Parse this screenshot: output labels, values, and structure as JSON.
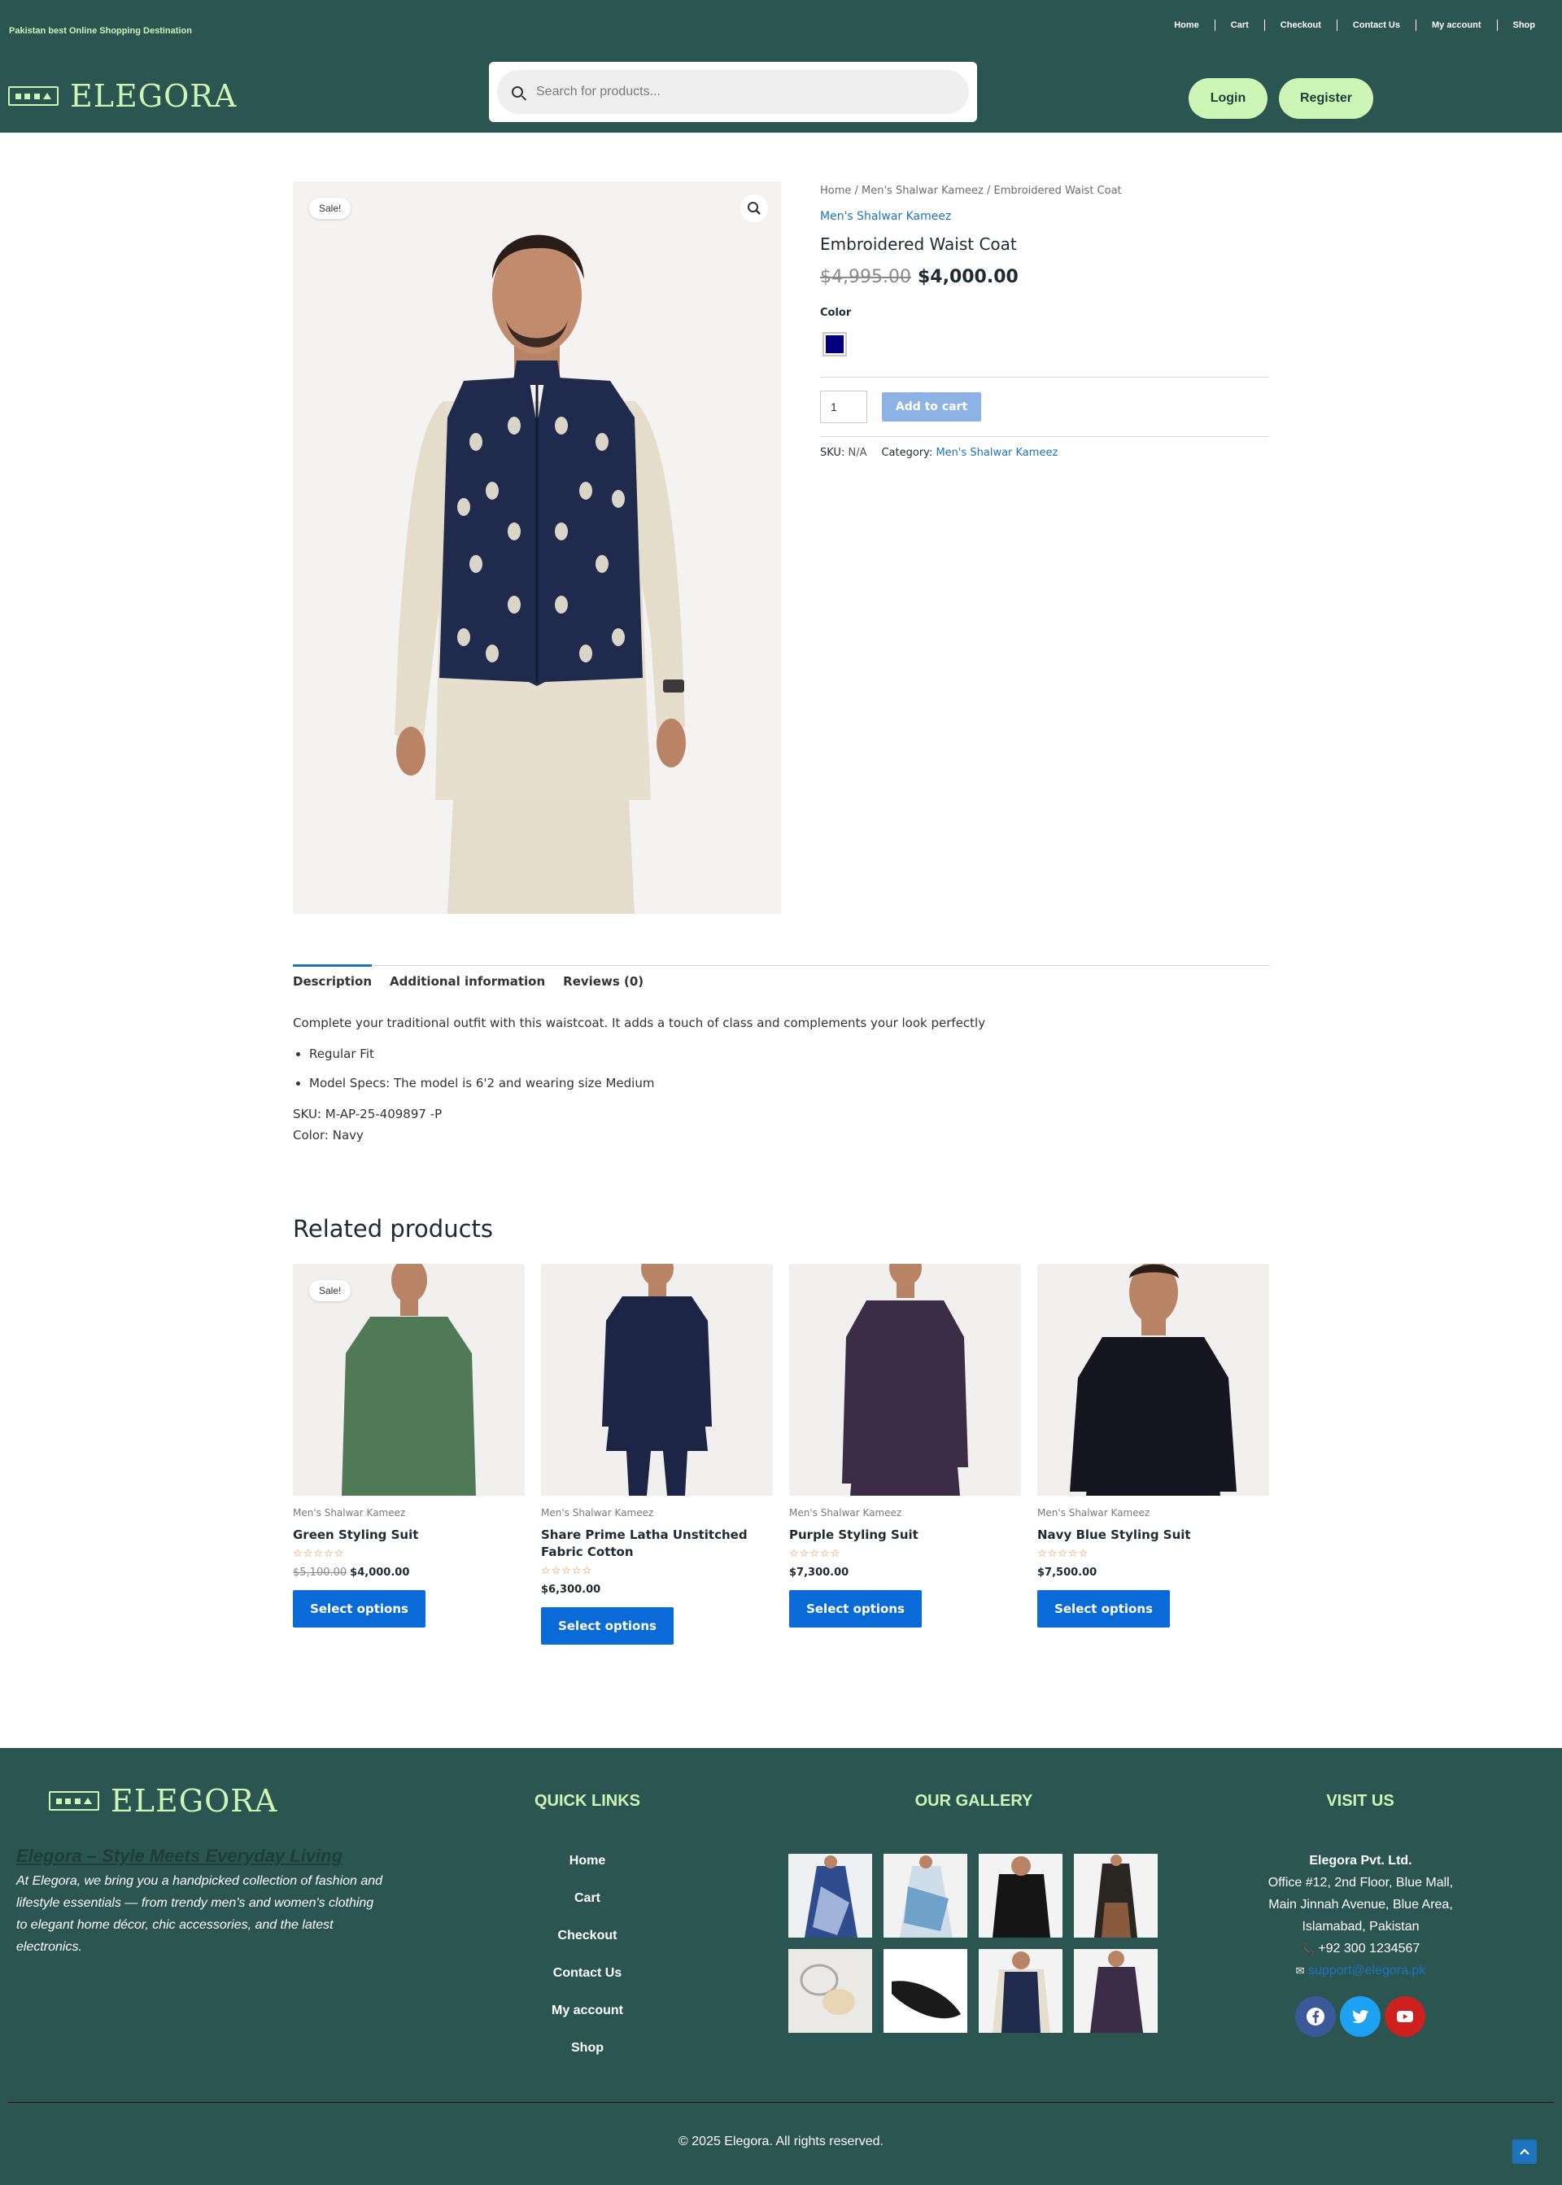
{
  "header": {
    "tagline": "Pakistan best Online Shopping Destination",
    "nav": [
      "Home",
      "Cart",
      "Checkout",
      "Contact Us",
      "My account",
      "Shop"
    ],
    "logo_text": "ELEGORA",
    "search_placeholder": "Search for products...",
    "login_label": "Login",
    "register_label": "Register"
  },
  "product": {
    "sale_badge": "Sale!",
    "breadcrumb": "Home / Men's Shalwar Kameez / Embroidered Waist Coat",
    "category": "Men's Shalwar Kameez",
    "title": "Embroidered Waist Coat",
    "old_price": "$4,995.00",
    "price": "$4,000.00",
    "color_label": "Color",
    "swatch_color": "#000080",
    "quantity": "1",
    "add_to_cart": "Add to cart",
    "sku_label": "SKU:",
    "sku_value": "N/A",
    "category_label": "Category:",
    "category_value": "Men's Shalwar Kameez"
  },
  "tabs": [
    "Description",
    "Additional information",
    "Reviews (0)"
  ],
  "description": {
    "intro": "Complete your traditional outfit with this waistcoat. It adds a touch of class and complements your look perfectly",
    "bullets": [
      "Regular Fit",
      "Model Specs: The model is 6'2 and wearing size Medium"
    ],
    "sku": "SKU: M-AP-25-409897 -P",
    "color": "Color: Navy"
  },
  "related": {
    "title": "Related products",
    "items": [
      {
        "category": "Men's Shalwar Kameez",
        "name": "Green Styling Suit",
        "old_price": "$5,100.00",
        "price": "$4,000.00",
        "badge": "Sale!",
        "stars": "☆☆☆☆☆",
        "button": "Select options",
        "cloth": "#4f7a55"
      },
      {
        "category": "Men's Shalwar Kameez",
        "name": "Share Prime Latha Unstitched Fabric Cotton",
        "old_price": "",
        "price": "$6,300.00",
        "badge": "",
        "stars": "☆☆☆☆☆",
        "button": "Select options",
        "cloth": "#1d2547"
      },
      {
        "category": "Men's Shalwar Kameez",
        "name": "Purple Styling Suit",
        "old_price": "",
        "price": "$7,300.00",
        "badge": "",
        "stars": "☆☆☆☆☆",
        "button": "Select options",
        "cloth": "#3a2d45"
      },
      {
        "category": "Men's Shalwar Kameez",
        "name": "Navy Blue Styling Suit",
        "old_price": "",
        "price": "$7,500.00",
        "badge": "",
        "stars": "☆☆☆☆☆",
        "button": "Select options",
        "cloth": "#15161f"
      }
    ]
  },
  "footer": {
    "logo_text": "ELEGORA",
    "tagline": "Elegora – Style Meets Everyday Living",
    "about": "At Elegora, we bring you a handpicked collection of fashion and lifestyle essentials — from trendy men's and women's clothing to elegant home décor, chic accessories, and the latest electronics.",
    "quick_links_heading": "QUICK LINKS",
    "quick_links": [
      "Home",
      "Cart",
      "Checkout",
      "Contact Us",
      "My account",
      "Shop"
    ],
    "gallery_heading": "OUR GALLERY",
    "visit_heading": "VISIT US",
    "company": "Elegora Pvt. Ltd.",
    "address": [
      "Office #12, 2nd Floor, Blue Mall,",
      "Main Jinnah Avenue, Blue Area,",
      "Islamabad, Pakistan"
    ],
    "phone": "+92 300 1234567",
    "email": "support@elegora.pk",
    "social": [
      {
        "icon": "facebook-icon",
        "color": "#3b5998"
      },
      {
        "icon": "twitter-icon",
        "color": "#1da1f2"
      },
      {
        "icon": "youtube-icon",
        "color": "#cd201f"
      }
    ],
    "copyright": "© 2025 Elegora. All rights reserved."
  },
  "colors": {
    "brand_dark": "#2b5551",
    "brand_light": "#cdf5b5",
    "link_blue": "#1e73be",
    "button_blue": "#0a6bd8"
  }
}
